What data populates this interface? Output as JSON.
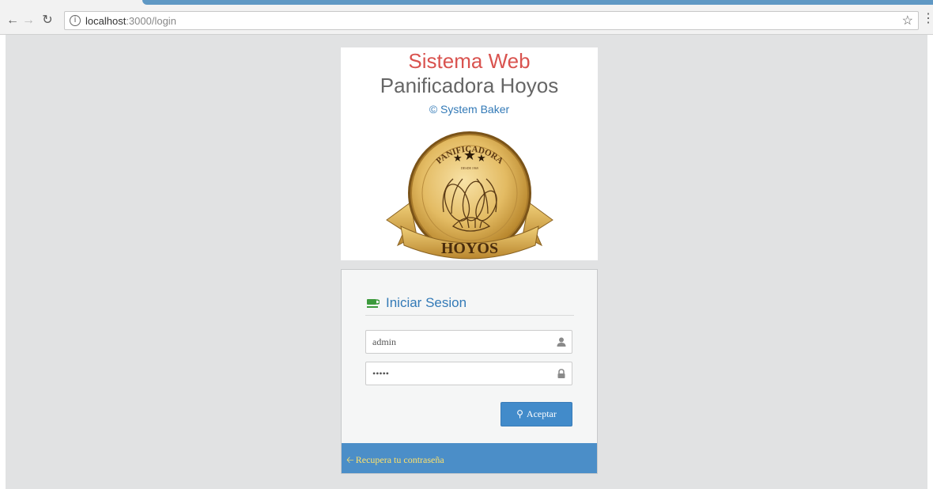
{
  "browser": {
    "url_host": "localhost",
    "url_path": ":3000/login"
  },
  "brand": {
    "title": "Sistema Web",
    "subtitle": "Panificadora Hoyos",
    "copyright": "© System Baker",
    "logo_top_text": "PANIFICADORA",
    "logo_since_text": "DESDE 1969",
    "logo_ribbon_text": "HOYOS"
  },
  "login": {
    "heading": "Iniciar Sesion",
    "username_value": "admin",
    "password_value": "admin",
    "submit_label": "Aceptar",
    "recover_label": "Recupera tu contraseña"
  },
  "colors": {
    "accent_blue": "#428bca",
    "title_red": "#d9534f",
    "link_yellow": "#ffe26b",
    "coffee_green": "#3c9a3c"
  }
}
